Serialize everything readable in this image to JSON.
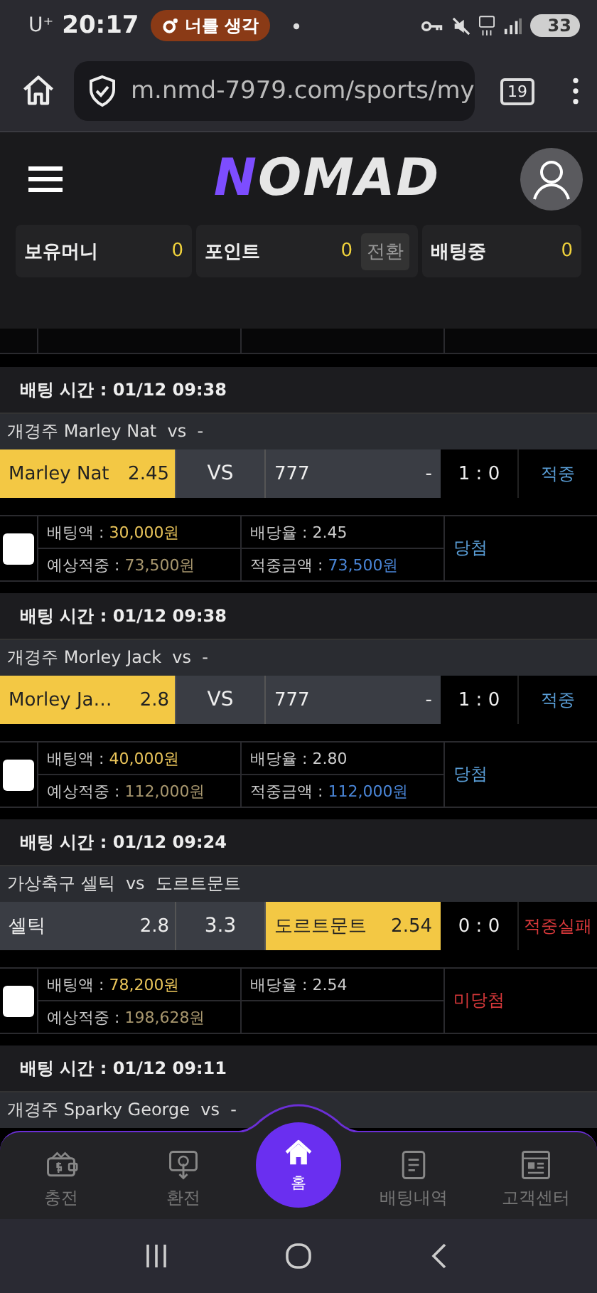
{
  "status_bar": {
    "carrier": "U⁺",
    "time": "20:17",
    "notification": "너를 생각",
    "battery": "33"
  },
  "browser": {
    "url": "m.nmd-7979.com/sports/my",
    "tab_count": "19"
  },
  "header": {
    "logo": "NOMAD"
  },
  "balances": [
    {
      "label": "보유머니",
      "value": "0"
    },
    {
      "label": "포인트",
      "value": "0",
      "action": "전환"
    },
    {
      "label": "배팅중",
      "value": "0"
    }
  ],
  "bets": [
    {
      "time": "배팅 시간 : 01/12 09:38",
      "title": "개경주 Marley Nat  vs  -",
      "odds": [
        {
          "kind": "team",
          "name": "Marley Nat",
          "price": "2.45",
          "selected": true
        },
        {
          "kind": "mid",
          "label": "VS",
          "selected": false
        },
        {
          "kind": "team",
          "name": "777",
          "price": "-",
          "selected": false
        }
      ],
      "score": "1 : 0",
      "result": {
        "text": "적중",
        "color": "#5a9fd8"
      },
      "checked": false,
      "stake": {
        "label": "배팅액 : ",
        "value": "30,000원"
      },
      "rate": "배당율 : 2.45",
      "expected": {
        "label": "예상적중 : ",
        "value": "73,500원"
      },
      "win": {
        "label": "적중금액 : ",
        "value": "73,500원"
      },
      "outcome": {
        "text": "당첨",
        "color": "#5a9fd8"
      }
    },
    {
      "time": "배팅 시간 : 01/12 09:38",
      "title": "개경주 Morley Jack  vs  -",
      "odds": [
        {
          "kind": "team",
          "name": "Morley Ja…",
          "price": "2.8",
          "selected": true
        },
        {
          "kind": "mid",
          "label": "VS",
          "selected": false
        },
        {
          "kind": "team",
          "name": "777",
          "price": "-",
          "selected": false
        }
      ],
      "score": "1 : 0",
      "result": {
        "text": "적중",
        "color": "#5a9fd8"
      },
      "checked": false,
      "stake": {
        "label": "배팅액 : ",
        "value": "40,000원"
      },
      "rate": "배당율 : 2.80",
      "expected": {
        "label": "예상적중 : ",
        "value": "112,000원"
      },
      "win": {
        "label": "적중금액 : ",
        "value": "112,000원"
      },
      "outcome": {
        "text": "당첨",
        "color": "#5a9fd8"
      }
    },
    {
      "time": "배팅 시간 : 01/12 09:24",
      "title": "가상축구 셀틱  vs  도르트문트",
      "odds": [
        {
          "kind": "team",
          "name": "셀틱",
          "price": "2.8",
          "selected": false
        },
        {
          "kind": "mid",
          "label": "3.3",
          "selected": false
        },
        {
          "kind": "team",
          "name": "도르트문트",
          "price": "2.54",
          "selected": true
        }
      ],
      "score": "0 : 0",
      "result": {
        "text": "적중실패",
        "color": "#d8383a"
      },
      "checked": false,
      "stake": {
        "label": "배팅액 : ",
        "value": "78,200원"
      },
      "rate": "배당율 : 2.54",
      "expected": {
        "label": "예상적중 : ",
        "value": "198,628원"
      },
      "outcome": {
        "text": "미당첨",
        "color": "#d8383a"
      }
    },
    {
      "time": "배팅 시간 : 01/12 09:11",
      "title": "개경주 Sparky George  vs  -"
    }
  ],
  "bottom_nav": [
    {
      "kind": "wallet",
      "label": "충전",
      "selected": false
    },
    {
      "kind": "exchange",
      "label": "환전",
      "selected": false
    },
    {
      "kind": "home",
      "label": "홈",
      "selected": true
    },
    {
      "kind": "list",
      "label": "배팅내역",
      "selected": false
    },
    {
      "kind": "support",
      "label": "고객센터",
      "selected": false
    }
  ]
}
